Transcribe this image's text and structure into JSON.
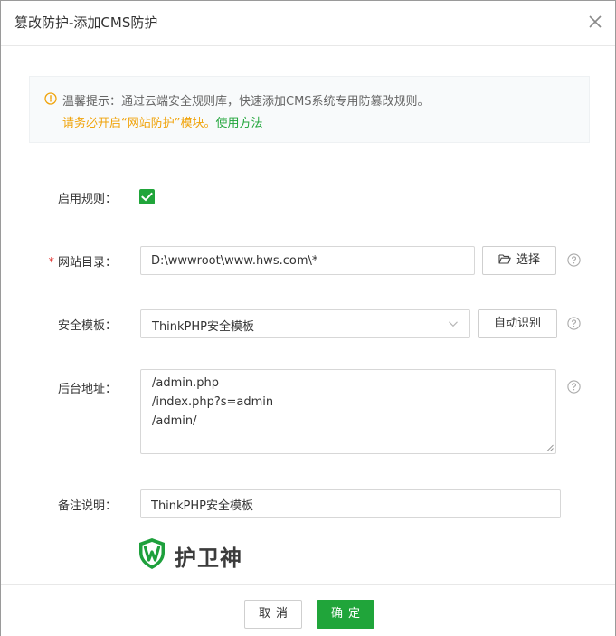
{
  "dialog": {
    "title": "篡改防护-添加CMS防护",
    "close_icon": "close-icon"
  },
  "notice": {
    "icon": "warning-circle-icon",
    "line1": "温馨提示：通过云端安全规则库，快速添加CMS系统专用防篡改规则。",
    "line2_warning": "请务必开启“网站防护”模块。",
    "line2_link": "使用方法"
  },
  "form": {
    "enable": {
      "label": "启用规则：",
      "checked": true
    },
    "site_dir": {
      "required_mark": "*",
      "label": "网站目录：",
      "value": "D:\\wwwroot\\www.hws.com\\*",
      "browse_label": "选择",
      "browse_icon": "folder-open-icon"
    },
    "template": {
      "label": "安全模板：",
      "selected": "ThinkPHP安全模板",
      "auto_detect_label": "自动识别"
    },
    "admin_paths": {
      "label": "后台地址：",
      "lines": [
        "/admin.php",
        "/index.php?s=admin",
        "/admin/"
      ]
    },
    "remark": {
      "label": "备注说明：",
      "value": "ThinkPHP安全模板"
    }
  },
  "brand": {
    "name": "护卫神",
    "icon": "huweishen-shield-logo"
  },
  "footer": {
    "cancel_label": "取消",
    "confirm_label": "确定"
  },
  "colors": {
    "accent": "#20a53a",
    "warning": "#f0a30a",
    "required": "#e0302c"
  }
}
